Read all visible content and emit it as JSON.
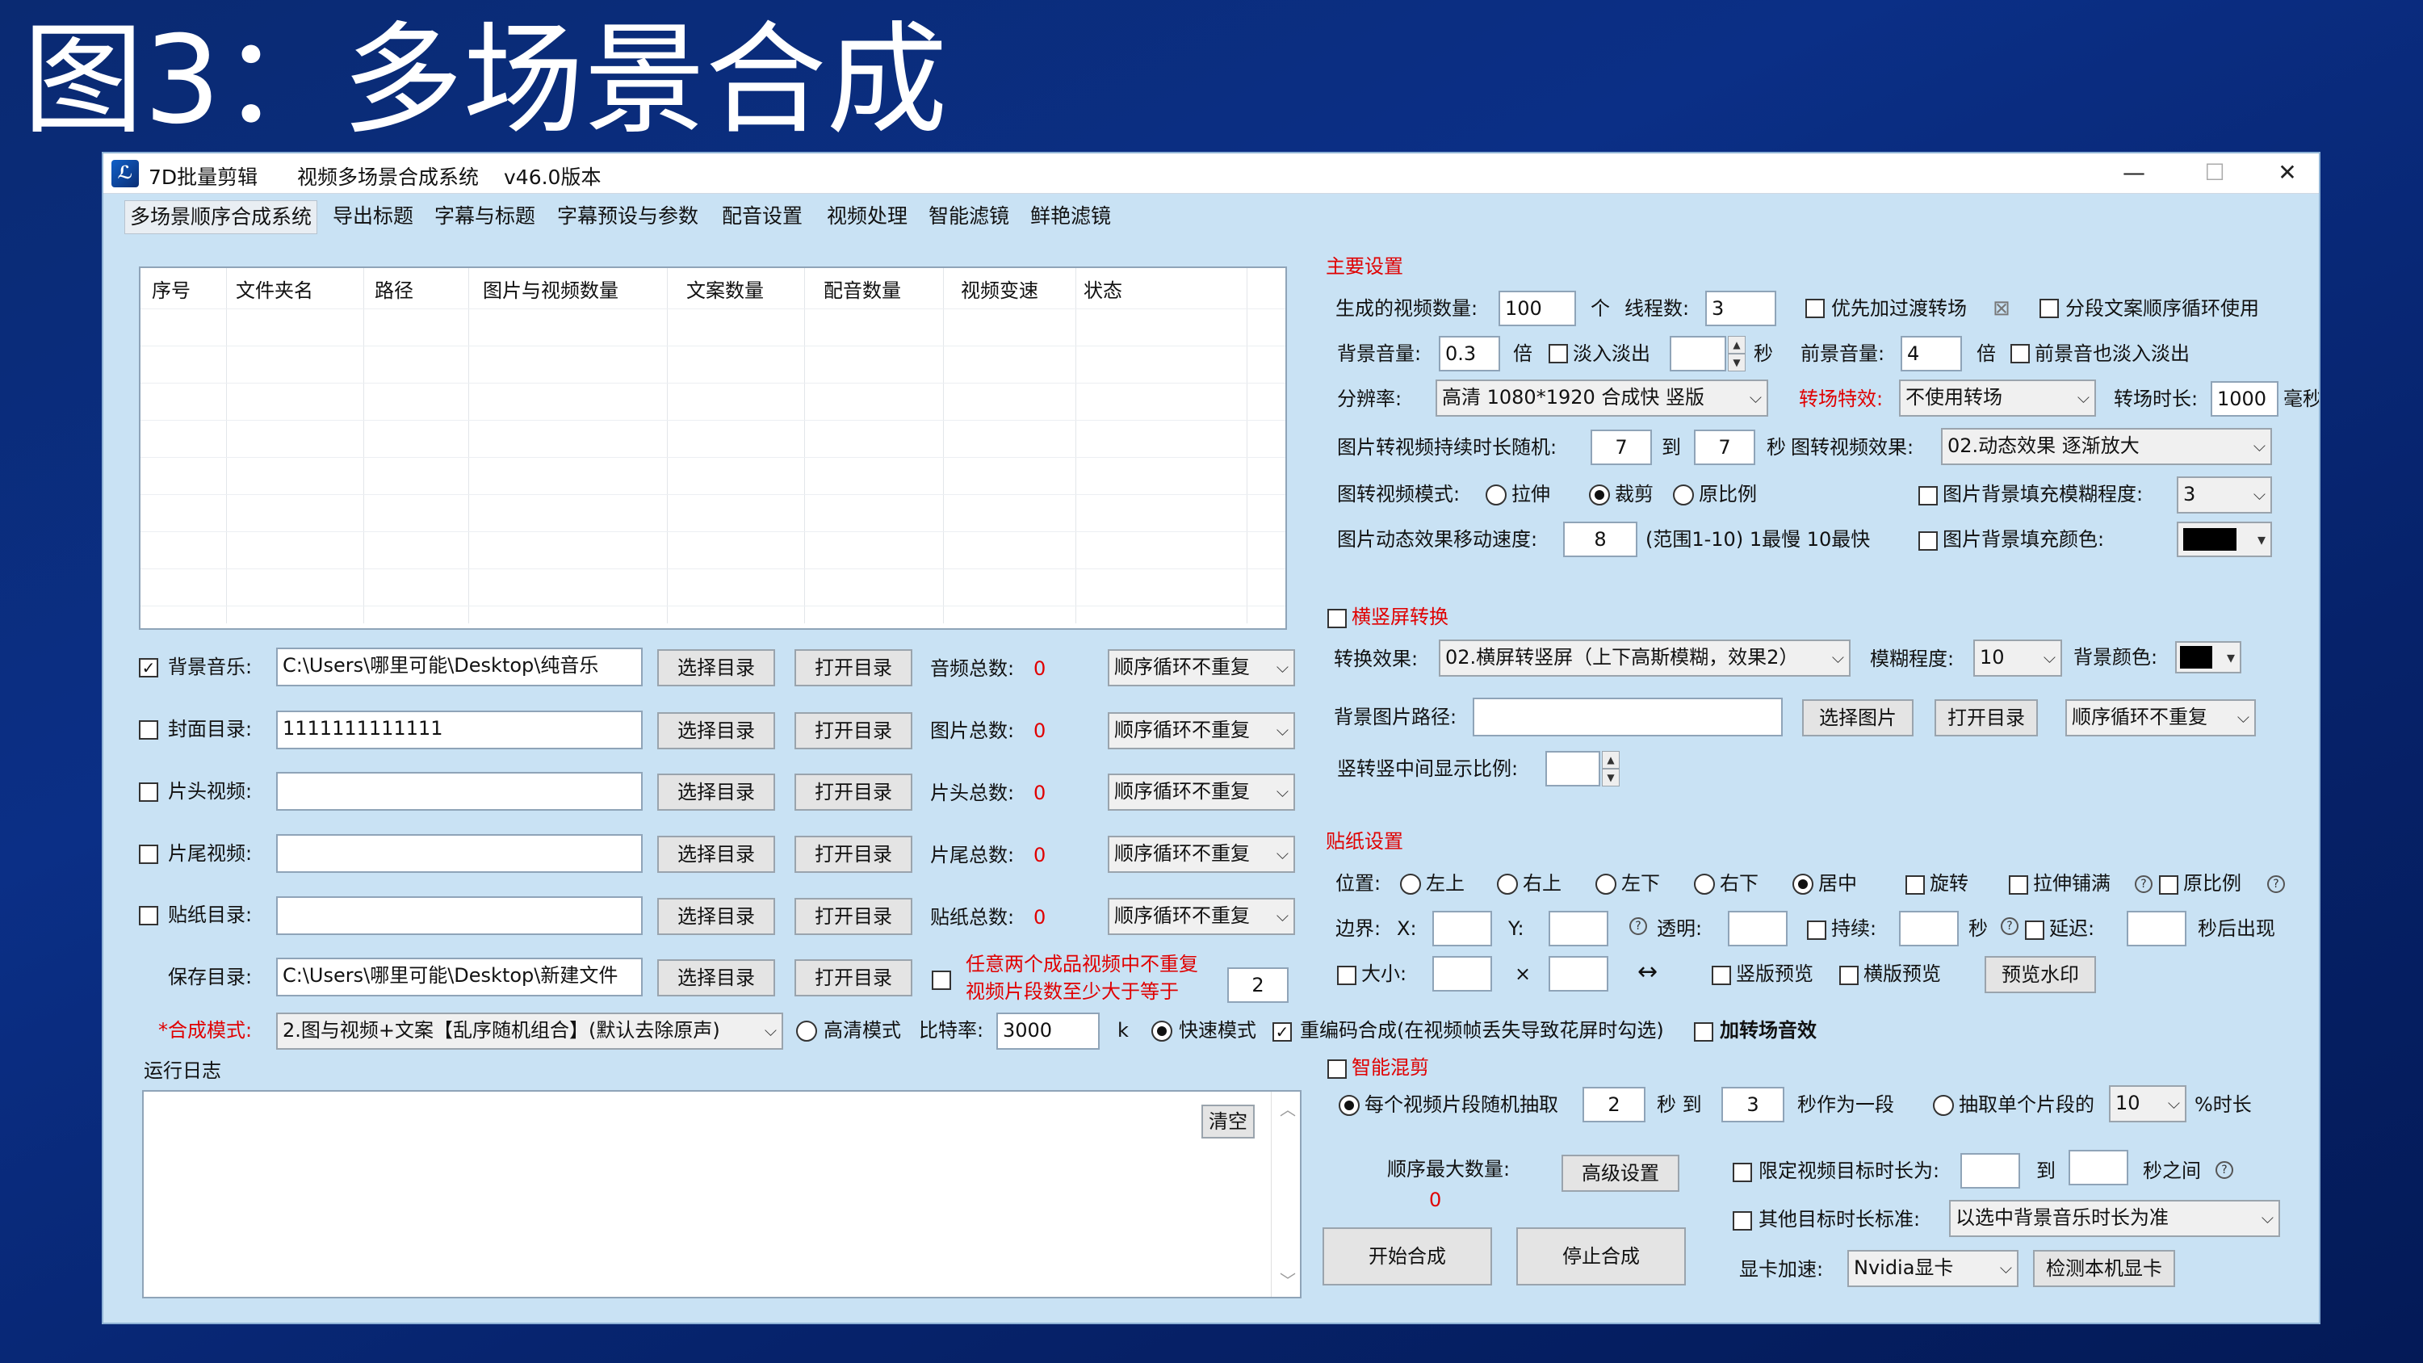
{
  "slide_title": "图3：多场景合成",
  "window": {
    "app_name": "7D批量剪辑",
    "system_name": "视频多场景合成系统",
    "version": "v46.0版本",
    "minimize": "—",
    "maximize": "☐",
    "close": "✕",
    "logo_text": "ℒ"
  },
  "menu": [
    "多场景顺序合成系统",
    "导出标题",
    "字幕与标题",
    "字幕预设与参数",
    "配音设置",
    "视频处理",
    "智能滤镜",
    "鲜艳滤镜"
  ],
  "table": {
    "columns": [
      "序号",
      "文件夹名",
      "路径",
      "图片与视频数量",
      "文案数量",
      "配音数量",
      "视频变速",
      "状态"
    ]
  },
  "left_rows": [
    {
      "check": true,
      "label": "背景音乐:",
      "value": "C:\\Users\\哪里可能\\Desktop\\纯音乐",
      "count_label": "音频总数:",
      "count": "0",
      "mode": "顺序循环不重复"
    },
    {
      "check": false,
      "label": "封面目录:",
      "value": "1111111111111",
      "count_label": "图片总数:",
      "count": "0",
      "mode": "顺序循环不重复"
    },
    {
      "check": false,
      "label": "片头视频:",
      "value": "",
      "count_label": "片头总数:",
      "count": "0",
      "mode": "顺序循环不重复"
    },
    {
      "check": false,
      "label": "片尾视频:",
      "value": "",
      "count_label": "片尾总数:",
      "count": "0",
      "mode": "顺序循环不重复"
    },
    {
      "check": false,
      "label": "贴纸目录:",
      "value": "",
      "count_label": "贴纸总数:",
      "count": "0",
      "mode": "顺序循环不重复"
    }
  ],
  "btn_select_dir": "选择目录",
  "btn_open_dir": "打开目录",
  "save": {
    "label": "保存目录:",
    "value": "C:\\Users\\哪里可能\\Desktop\\新建文件",
    "note_line1": "任意两个成品视频中不重复",
    "note_line2": "视频片段数至少大于等于",
    "note_value": "2"
  },
  "compose": {
    "label": "*合成模式:",
    "mode": "2.图与视频+文案【乱序随机组合】(默认去除原声)",
    "hd_mode": "高清模式",
    "bitrate_label": "比特率:",
    "bitrate": "3000",
    "bitrate_unit": "k",
    "fast_mode": "快速模式",
    "reencode": "重编码合成(在视频帧丢失导致花屏时勾选)",
    "transition_sound": "加转场音效"
  },
  "log": {
    "label": "运行日志",
    "clear": "清空"
  },
  "main_settings": {
    "header": "主要设置",
    "gen_count_label": "生成的视频数量:",
    "gen_count": "100",
    "gen_unit": "个",
    "threads_label": "线程数:",
    "threads": "3",
    "prefer_transition": "优先加过渡转场",
    "segment_loop": "分段文案顺序循环使用",
    "bg_volume_label": "背景音量:",
    "bg_volume": "0.3",
    "times_unit": "倍",
    "fade": "淡入淡出",
    "fade_value": "",
    "sec_unit": "秒",
    "fg_volume_label": "前景音量:",
    "fg_volume": "4",
    "fg_fade": "前景音也淡入淡出",
    "resolution_label": "分辨率:",
    "resolution": "高清 1080*1920 合成快 竖版",
    "transition_fx_label": "转场特效:",
    "transition_fx": "不使用转场",
    "transition_dur_label": "转场时长:",
    "transition_dur": "1000",
    "ms_unit": "毫秒",
    "img_dur_label": "图片转视频持续时长随机:",
    "img_dur_from": "7",
    "to_label": "到",
    "img_dur_to": "7",
    "img_fx_label": "图转视频效果:",
    "img_fx": "02.动态效果 逐渐放大",
    "img_mode_label": "图转视频模式:",
    "mode_stretch": "拉伸",
    "mode_crop": "裁剪",
    "mode_ratio": "原比例",
    "blur_fill_label": "图片背景填充模糊程度:",
    "blur_fill": "3",
    "speed_label": "图片动态效果移动速度:",
    "speed": "8",
    "speed_note": "(范围1-10) 1最慢 10最快",
    "color_fill_label": "图片背景填充颜色:",
    "color_fill": "#000000"
  },
  "orientation": {
    "header": "横竖屏转换",
    "effect_label": "转换效果:",
    "effect": "02.横屏转竖屏（上下高斯模糊，效果2）",
    "blur_label": "模糊程度:",
    "blur": "10",
    "bg_color_label": "背景颜色:",
    "bg_color": "#000000",
    "bg_img_label": "背景图片路径:",
    "bg_img": "",
    "select_img": "选择图片",
    "open_dir": "打开目录",
    "mode": "顺序循环不重复",
    "ratio_label": "竖转竖中间显示比例:",
    "ratio": ""
  },
  "sticker": {
    "header": "贴纸设置",
    "pos_label": "位置:",
    "positions": [
      "左上",
      "右上",
      "左下",
      "右下",
      "居中"
    ],
    "rotate": "旋转",
    "stretch": "拉伸铺满",
    "original": "原比例",
    "border_label": "边界:",
    "x_label": "X:",
    "y_label": "Y:",
    "alpha_label": "透明:",
    "duration_label": "持续:",
    "delay_label": "延迟:",
    "after": "秒后出现",
    "size_label": "大小:",
    "x_sign": "×",
    "swap_icon": "↔",
    "v_preview": "竖版预览",
    "h_preview": "横版预览",
    "preview_btn": "预览水印"
  },
  "smart": {
    "header": "智能混剪",
    "random_label": "每个视频片段随机抽取",
    "from": "2",
    "sec_to": "秒 到",
    "to": "3",
    "per_segment": "秒作为一段",
    "single_label": "抽取单个片段的",
    "single_value": "10",
    "percent": "%时长",
    "max_label": "顺序最大数量:",
    "max_value": "0",
    "advanced": "高级设置",
    "limit_label": "限定视频目标时长为:",
    "limit_to": "到",
    "limit_between": "秒之间",
    "other_label": "其他目标时长标准:",
    "other_value": "以选中背景音乐时长为准",
    "start": "开始合成",
    "stop": "停止合成",
    "gpu_label": "显卡加速:",
    "gpu": "Nvidia显卡",
    "detect": "检测本机显卡"
  }
}
